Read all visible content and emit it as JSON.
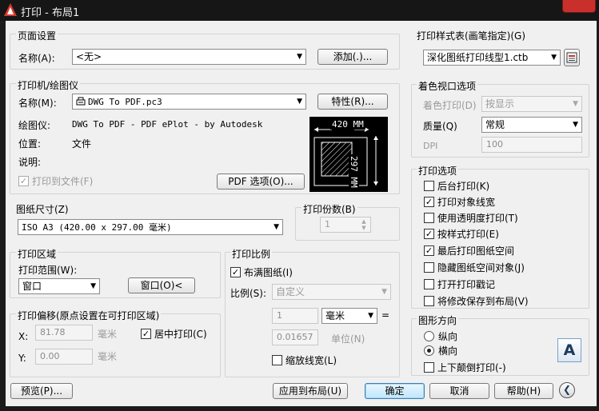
{
  "window": {
    "title": "打印 - 布局1"
  },
  "page_setup": {
    "group": "页面设置",
    "name_label": "名称(A):",
    "name_value": "<无>",
    "add_button": "添加(.)..."
  },
  "printer": {
    "group": "打印机/绘图仪",
    "name_label": "名称(M):",
    "name_value": "DWG To PDF.pc3",
    "properties_button": "特性(R)...",
    "plotter_label": "绘图仪:",
    "plotter_value": "DWG To PDF - PDF ePlot - by Autodesk",
    "location_label": "位置:",
    "location_value": "文件",
    "description_label": "说明:",
    "print_to_file": "打印到文件(F)",
    "print_to_file_checked": true,
    "pdf_options_button": "PDF 选项(O)...",
    "preview_width": "420 MM",
    "preview_height": "297 MM"
  },
  "paper_size": {
    "group": "图纸尺寸(Z)",
    "value": "ISO A3 (420.00 x 297.00 毫米)"
  },
  "copies": {
    "group": "打印份数(B)",
    "value": "1"
  },
  "plot_area": {
    "group": "打印区域",
    "range_label": "打印范围(W):",
    "range_value": "窗口",
    "window_button": "窗口(O)<"
  },
  "plot_offset": {
    "group": "打印偏移(原点设置在可打印区域)",
    "x_label": "X:",
    "x_value": "81.78",
    "y_label": "Y:",
    "y_value": "0.00",
    "unit_x": "毫米",
    "unit_y": "毫米",
    "center_plot": "居中打印(C)",
    "center_plot_checked": true
  },
  "plot_scale": {
    "group": "打印比例",
    "fit_to_paper": "布满图纸(I)",
    "fit_to_paper_checked": true,
    "scale_label": "比例(S):",
    "scale_value": "自定义",
    "num_value": "1",
    "unit_value": "毫米",
    "equals": "=",
    "den_value": "0.01657",
    "unit2_label": "单位(N)",
    "scale_lineweights": "缩放线宽(L)",
    "scale_lineweights_checked": false
  },
  "plot_style_table": {
    "group": "打印样式表(画笔指定)(G)",
    "value": "深化图纸打印线型1.ctb"
  },
  "shaded_viewport": {
    "group": "着色视口选项",
    "shade_plot_label": "着色打印(D)",
    "shade_plot_value": "按显示",
    "quality_label": "质量(Q)",
    "quality_value": "常规",
    "dpi_label": "DPI",
    "dpi_value": "100"
  },
  "plot_options": {
    "group": "打印选项",
    "items": [
      {
        "label": "后台打印(K)",
        "checked": false
      },
      {
        "label": "打印对象线宽",
        "checked": true
      },
      {
        "label": "使用透明度打印(T)",
        "checked": false
      },
      {
        "label": "按样式打印(E)",
        "checked": true
      },
      {
        "label": "最后打印图纸空间",
        "checked": true
      },
      {
        "label": "隐藏图纸空间对象(J)",
        "checked": false
      },
      {
        "label": "打开打印戳记",
        "checked": false
      },
      {
        "label": "将修改保存到布局(V)",
        "checked": false
      }
    ]
  },
  "orientation": {
    "group": "图形方向",
    "portrait": "纵向",
    "portrait_selected": false,
    "landscape": "横向",
    "landscape_selected": true,
    "upside_down": "上下颠倒打印(-)",
    "upside_down_checked": false,
    "icon_letter": "A"
  },
  "footer": {
    "preview": "预览(P)...",
    "apply_to_layout": "应用到布局(U)",
    "ok": "确定",
    "cancel": "取消",
    "help": "帮助(H)"
  }
}
